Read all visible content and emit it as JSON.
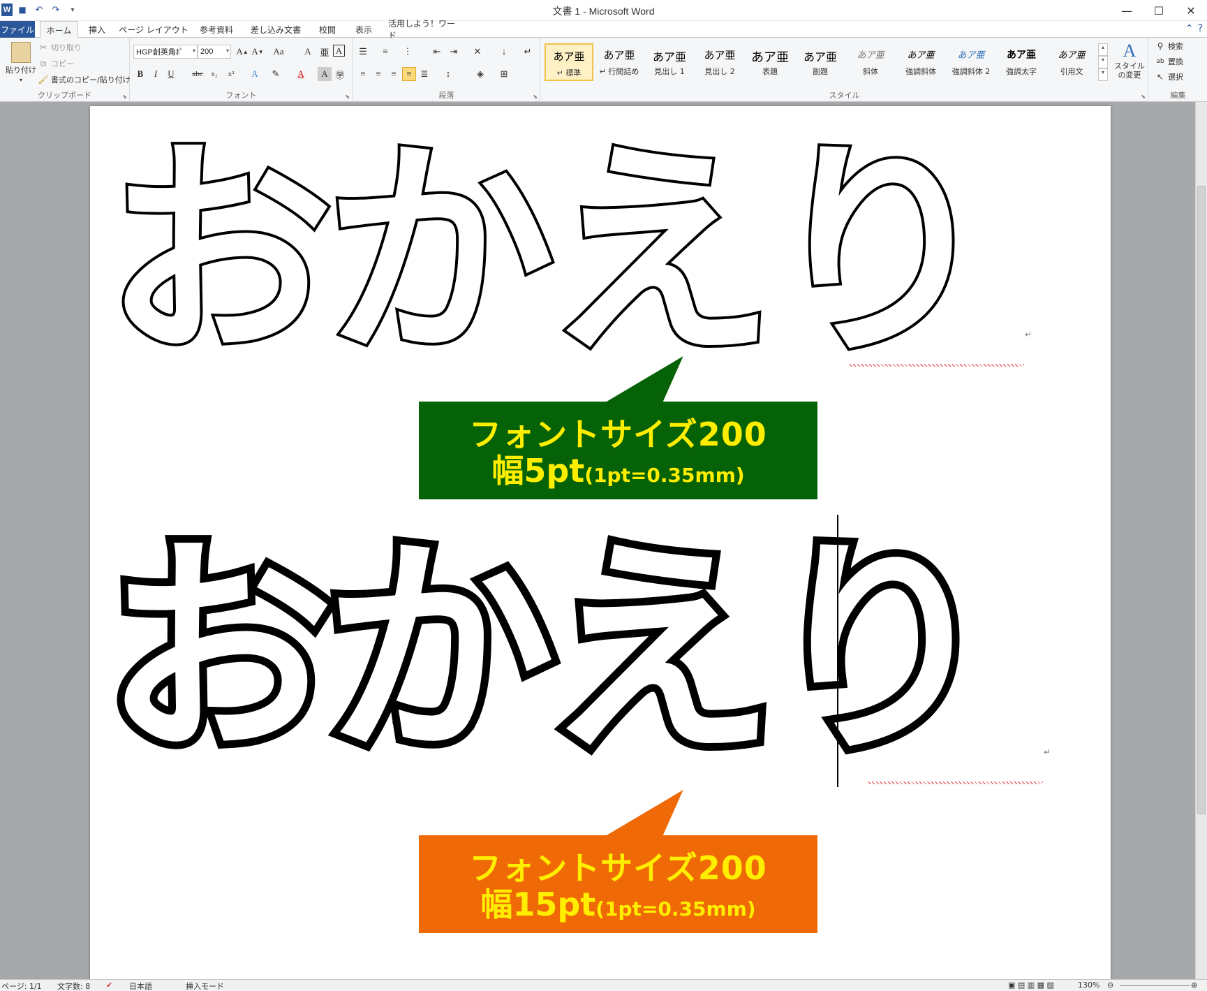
{
  "window": {
    "title": "文書 1 - Microsoft Word",
    "controls": {
      "minimize": "—",
      "maximize": "☐",
      "close": "✕"
    }
  },
  "qat": {
    "app_icon": "W",
    "save": "💾",
    "undo": "↶",
    "redo": "↷",
    "customize": "▾"
  },
  "tabs": [
    {
      "label": "ファイル"
    },
    {
      "label": "ホーム"
    },
    {
      "label": "挿入"
    },
    {
      "label": "ページ レイアウト"
    },
    {
      "label": "参考資料"
    },
    {
      "label": "差し込み文書"
    },
    {
      "label": "校閲"
    },
    {
      "label": "表示"
    },
    {
      "label": "活用しよう！ワード"
    }
  ],
  "ribbon": {
    "clipboard": {
      "label": "クリップボード",
      "paste": "貼り付け",
      "cut": "切り取り",
      "copy": "コピー",
      "format_painter": "書式のコピー/貼り付け"
    },
    "font": {
      "label": "フォント",
      "font_name": "HGP創英角ﾎﾟ",
      "font_size": "200"
    },
    "paragraph": {
      "label": "段落"
    },
    "styles": {
      "label": "スタイル",
      "items": [
        {
          "preview": "あア亜",
          "name": "↵ 標準"
        },
        {
          "preview": "あア亜",
          "name": "↵ 行間詰め"
        },
        {
          "preview": "あア亜",
          "name": "見出し 1"
        },
        {
          "preview": "あア亜",
          "name": "見出し 2"
        },
        {
          "preview": "あア亜",
          "name": "表題"
        },
        {
          "preview": "あア亜",
          "name": "副題"
        },
        {
          "preview": "あア亜",
          "name": "斜体"
        },
        {
          "preview": "あア亜",
          "name": "強調斜体"
        },
        {
          "preview": "あア亜",
          "name": "強調斜体 2"
        },
        {
          "preview": "あア亜",
          "name": "強調太字"
        },
        {
          "preview": "あア亜",
          "name": "引用文"
        }
      ],
      "change_styles": "スタイルの変更"
    },
    "editing": {
      "label": "編集",
      "find": "検索",
      "replace": "置換",
      "select": "選択"
    }
  },
  "document": {
    "text1": "おかえり",
    "text2": "おかえり",
    "callout1": {
      "line1": "フォントサイズ200",
      "line2_main": "幅5pt",
      "line2_sub": "(1pt=0.35mm)",
      "color": "#066206"
    },
    "callout2": {
      "line1": "フォントサイズ200",
      "line2_main": "幅15pt",
      "line2_sub": "(1pt=0.35mm)",
      "color": "#ef6a06"
    },
    "para_mark": "↵"
  },
  "statusbar": {
    "page": "ページ: 1/1",
    "words": "文字数: 8",
    "language": "日本語",
    "mode": "挿入モード",
    "zoom": "130%"
  }
}
